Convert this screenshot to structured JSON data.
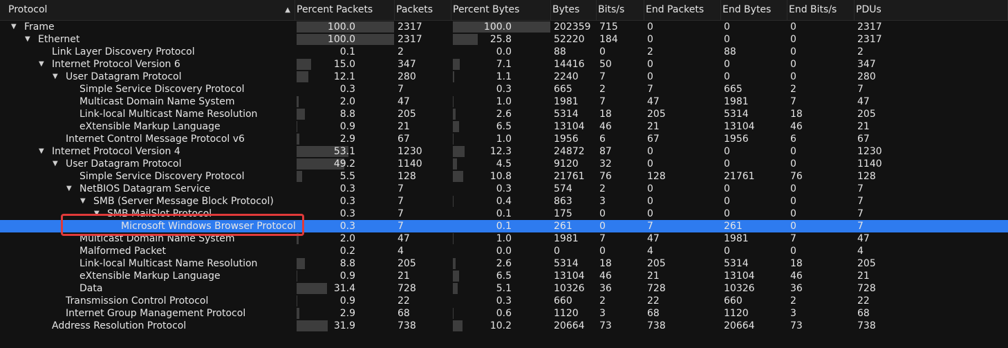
{
  "columns": [
    {
      "key": "protocol",
      "label": "Protocol",
      "sorted": true
    },
    {
      "key": "pct_packets",
      "label": "Percent Packets"
    },
    {
      "key": "packets",
      "label": "Packets"
    },
    {
      "key": "pct_bytes",
      "label": "Percent Bytes"
    },
    {
      "key": "bytes",
      "label": "Bytes"
    },
    {
      "key": "bits_s",
      "label": "Bits/s"
    },
    {
      "key": "end_packets",
      "label": "End Packets"
    },
    {
      "key": "end_bytes",
      "label": "End Bytes"
    },
    {
      "key": "end_bits_s",
      "label": "End Bits/s"
    },
    {
      "key": "pdus",
      "label": "PDUs"
    }
  ],
  "rows": [
    {
      "name": "Frame",
      "level": 0,
      "expanded": true,
      "pct_packets": "100.0",
      "packets": "2317",
      "pct_bytes": "100.0",
      "bytes": "202359",
      "bits_s": "715",
      "end_packets": "0",
      "end_bytes": "0",
      "end_bits_s": "0",
      "pdus": "2317"
    },
    {
      "name": "Ethernet",
      "level": 1,
      "expanded": true,
      "pct_packets": "100.0",
      "packets": "2317",
      "pct_bytes": "25.8",
      "bytes": "52220",
      "bits_s": "184",
      "end_packets": "0",
      "end_bytes": "0",
      "end_bits_s": "0",
      "pdus": "2317"
    },
    {
      "name": "Link Layer Discovery Protocol",
      "level": 2,
      "pct_packets": "0.1",
      "packets": "2",
      "pct_bytes": "0.0",
      "bytes": "88",
      "bits_s": "0",
      "end_packets": "2",
      "end_bytes": "88",
      "end_bits_s": "0",
      "pdus": "2"
    },
    {
      "name": "Internet Protocol Version 6",
      "level": 2,
      "expanded": true,
      "pct_packets": "15.0",
      "packets": "347",
      "pct_bytes": "7.1",
      "bytes": "14416",
      "bits_s": "50",
      "end_packets": "0",
      "end_bytes": "0",
      "end_bits_s": "0",
      "pdus": "347"
    },
    {
      "name": "User Datagram Protocol",
      "level": 3,
      "expanded": true,
      "pct_packets": "12.1",
      "packets": "280",
      "pct_bytes": "1.1",
      "bytes": "2240",
      "bits_s": "7",
      "end_packets": "0",
      "end_bytes": "0",
      "end_bits_s": "0",
      "pdus": "280"
    },
    {
      "name": "Simple Service Discovery Protocol",
      "level": 4,
      "pct_packets": "0.3",
      "packets": "7",
      "pct_bytes": "0.3",
      "bytes": "665",
      "bits_s": "2",
      "end_packets": "7",
      "end_bytes": "665",
      "end_bits_s": "2",
      "pdus": "7"
    },
    {
      "name": "Multicast Domain Name System",
      "level": 4,
      "pct_packets": "2.0",
      "packets": "47",
      "pct_bytes": "1.0",
      "bytes": "1981",
      "bits_s": "7",
      "end_packets": "47",
      "end_bytes": "1981",
      "end_bits_s": "7",
      "pdus": "47"
    },
    {
      "name": "Link-local Multicast Name Resolution",
      "level": 4,
      "pct_packets": "8.8",
      "packets": "205",
      "pct_bytes": "2.6",
      "bytes": "5314",
      "bits_s": "18",
      "end_packets": "205",
      "end_bytes": "5314",
      "end_bits_s": "18",
      "pdus": "205"
    },
    {
      "name": "eXtensible Markup Language",
      "level": 4,
      "pct_packets": "0.9",
      "packets": "21",
      "pct_bytes": "6.5",
      "bytes": "13104",
      "bits_s": "46",
      "end_packets": "21",
      "end_bytes": "13104",
      "end_bits_s": "46",
      "pdus": "21"
    },
    {
      "name": "Internet Control Message Protocol v6",
      "level": 3,
      "pct_packets": "2.9",
      "packets": "67",
      "pct_bytes": "1.0",
      "bytes": "1956",
      "bits_s": "6",
      "end_packets": "67",
      "end_bytes": "1956",
      "end_bits_s": "6",
      "pdus": "67"
    },
    {
      "name": "Internet Protocol Version 4",
      "level": 2,
      "expanded": true,
      "pct_packets": "53.1",
      "packets": "1230",
      "pct_bytes": "12.3",
      "bytes": "24872",
      "bits_s": "87",
      "end_packets": "0",
      "end_bytes": "0",
      "end_bits_s": "0",
      "pdus": "1230"
    },
    {
      "name": "User Datagram Protocol",
      "level": 3,
      "expanded": true,
      "pct_packets": "49.2",
      "packets": "1140",
      "pct_bytes": "4.5",
      "bytes": "9120",
      "bits_s": "32",
      "end_packets": "0",
      "end_bytes": "0",
      "end_bits_s": "0",
      "pdus": "1140"
    },
    {
      "name": "Simple Service Discovery Protocol",
      "level": 4,
      "pct_packets": "5.5",
      "packets": "128",
      "pct_bytes": "10.8",
      "bytes": "21761",
      "bits_s": "76",
      "end_packets": "128",
      "end_bytes": "21761",
      "end_bits_s": "76",
      "pdus": "128"
    },
    {
      "name": "NetBIOS Datagram Service",
      "level": 4,
      "expanded": true,
      "pct_packets": "0.3",
      "packets": "7",
      "pct_bytes": "0.3",
      "bytes": "574",
      "bits_s": "2",
      "end_packets": "0",
      "end_bytes": "0",
      "end_bits_s": "0",
      "pdus": "7"
    },
    {
      "name": "SMB (Server Message Block Protocol)",
      "level": 5,
      "expanded": true,
      "pct_packets": "0.3",
      "packets": "7",
      "pct_bytes": "0.4",
      "bytes": "863",
      "bits_s": "3",
      "end_packets": "0",
      "end_bytes": "0",
      "end_bits_s": "0",
      "pdus": "7"
    },
    {
      "name": "SMB MailSlot Protocol",
      "level": 6,
      "expanded": true,
      "pct_packets": "0.3",
      "packets": "7",
      "pct_bytes": "0.1",
      "bytes": "175",
      "bits_s": "0",
      "end_packets": "0",
      "end_bytes": "0",
      "end_bits_s": "0",
      "pdus": "7"
    },
    {
      "name": "Microsoft Windows Browser Protocol",
      "level": 7,
      "selected": true,
      "pct_packets": "0.3",
      "packets": "7",
      "pct_bytes": "0.1",
      "bytes": "261",
      "bits_s": "0",
      "end_packets": "7",
      "end_bytes": "261",
      "end_bits_s": "0",
      "pdus": "7"
    },
    {
      "name": "Multicast Domain Name System",
      "level": 4,
      "pct_packets": "2.0",
      "packets": "47",
      "pct_bytes": "1.0",
      "bytes": "1981",
      "bits_s": "7",
      "end_packets": "47",
      "end_bytes": "1981",
      "end_bits_s": "7",
      "pdus": "47"
    },
    {
      "name": "Malformed Packet",
      "level": 4,
      "pct_packets": "0.2",
      "packets": "4",
      "pct_bytes": "0.0",
      "bytes": "0",
      "bits_s": "0",
      "end_packets": "4",
      "end_bytes": "0",
      "end_bits_s": "0",
      "pdus": "4"
    },
    {
      "name": "Link-local Multicast Name Resolution",
      "level": 4,
      "pct_packets": "8.8",
      "packets": "205",
      "pct_bytes": "2.6",
      "bytes": "5314",
      "bits_s": "18",
      "end_packets": "205",
      "end_bytes": "5314",
      "end_bits_s": "18",
      "pdus": "205"
    },
    {
      "name": "eXtensible Markup Language",
      "level": 4,
      "pct_packets": "0.9",
      "packets": "21",
      "pct_bytes": "6.5",
      "bytes": "13104",
      "bits_s": "46",
      "end_packets": "21",
      "end_bytes": "13104",
      "end_bits_s": "46",
      "pdus": "21"
    },
    {
      "name": "Data",
      "level": 4,
      "pct_packets": "31.4",
      "packets": "728",
      "pct_bytes": "5.1",
      "bytes": "10326",
      "bits_s": "36",
      "end_packets": "728",
      "end_bytes": "10326",
      "end_bits_s": "36",
      "pdus": "728"
    },
    {
      "name": "Transmission Control Protocol",
      "level": 3,
      "pct_packets": "0.9",
      "packets": "22",
      "pct_bytes": "0.3",
      "bytes": "660",
      "bits_s": "2",
      "end_packets": "22",
      "end_bytes": "660",
      "end_bits_s": "2",
      "pdus": "22"
    },
    {
      "name": "Internet Group Management Protocol",
      "level": 3,
      "pct_packets": "2.9",
      "packets": "68",
      "pct_bytes": "0.6",
      "bytes": "1120",
      "bits_s": "3",
      "end_packets": "68",
      "end_bytes": "1120",
      "end_bits_s": "3",
      "pdus": "68"
    },
    {
      "name": "Address Resolution Protocol",
      "level": 2,
      "pct_packets": "31.9",
      "packets": "738",
      "pct_bytes": "10.2",
      "bytes": "20664",
      "bits_s": "73",
      "end_packets": "738",
      "end_bytes": "20664",
      "end_bits_s": "73",
      "pdus": "738"
    }
  ],
  "colors": {
    "background": "#121212",
    "header": "#1b1b1b",
    "bar": "#3d3d3d",
    "selection": "#2e7bef",
    "highlight_box": "#e03a3a",
    "text": "#e6e6e6"
  },
  "icons": {
    "expanded": "triangle-down-icon",
    "sort": "sort-ascending-icon"
  }
}
